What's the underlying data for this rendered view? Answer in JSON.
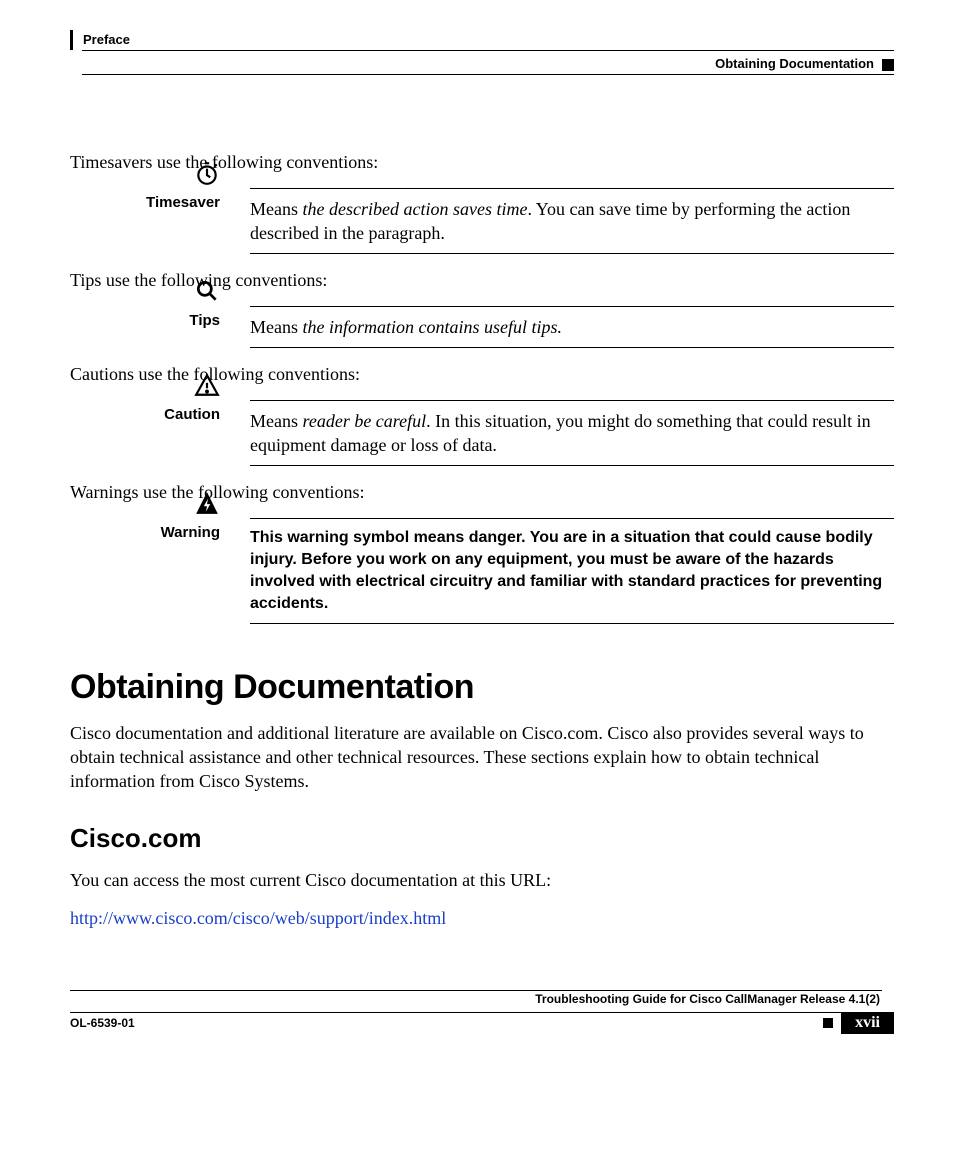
{
  "header": {
    "left": "Preface",
    "right": "Obtaining Documentation"
  },
  "intro": {
    "timesaver": "Timesavers use the following conventions:",
    "tips": "Tips use the following conventions:",
    "caution": "Cautions use the following conventions:",
    "warning": "Warnings use the following conventions:"
  },
  "labels": {
    "timesaver": "Timesaver",
    "tips": "Tips",
    "caution": "Caution",
    "warning": "Warning"
  },
  "conv": {
    "timesaver_pre": "Means ",
    "timesaver_em": "the described action saves time",
    "timesaver_post": ". You can save time by performing the action described in the paragraph.",
    "tips_pre": "Means ",
    "tips_em": "the information contains useful tips.",
    "caution_pre": " Means ",
    "caution_em": "reader be careful",
    "caution_post": ". In this situation, you might do something that could result in equipment damage or loss of data.",
    "warning": "This warning symbol means danger. You are in a situation that could cause bodily injury. Before you work on any equipment, you must be aware of the hazards involved with electrical circuitry and familiar with standard practices for preventing accidents."
  },
  "h1": "Obtaining Documentation",
  "p_obtain": "Cisco documentation and additional literature are available on Cisco.com. Cisco also provides several ways to obtain technical assistance and other technical resources. These sections explain how to obtain technical information from Cisco Systems.",
  "h2": "Cisco.com",
  "p_cisco": "You can access the most current Cisco documentation at this URL:",
  "url": "http://www.cisco.com/cisco/web/support/index.html",
  "footer": {
    "title": "Troubleshooting Guide for Cisco CallManager Release 4.1(2)",
    "doc_id": "OL-6539-01",
    "page": "xvii"
  }
}
